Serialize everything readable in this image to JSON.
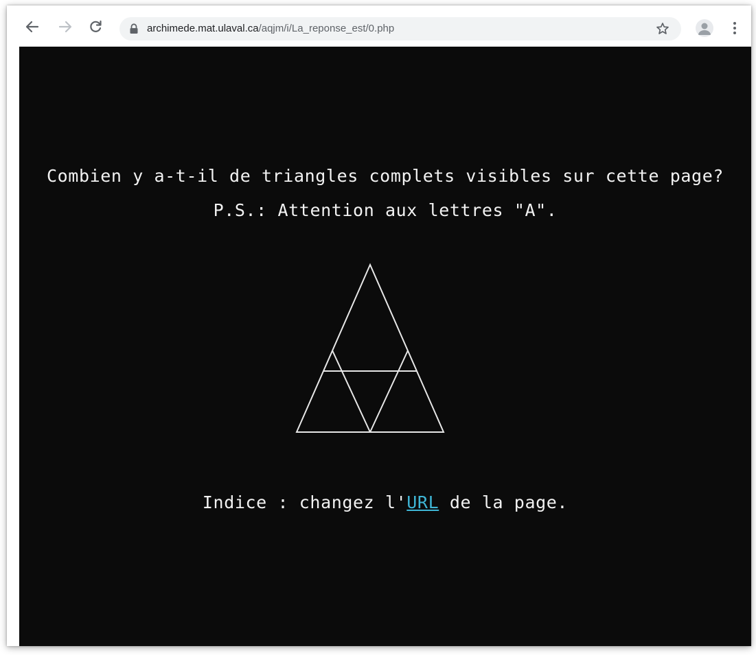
{
  "browser": {
    "url_host": "archimede.mat.ulaval.ca",
    "url_path": "/aqjm/i/La_reponse_est/0.php",
    "icons": [
      "back-arrow-icon",
      "forward-arrow-icon",
      "reload-icon",
      "lock-icon",
      "star-icon",
      "profile-avatar-icon",
      "kebab-menu-icon"
    ]
  },
  "page": {
    "question": "Combien y a-t-il de triangles complets visibles sur cette page?",
    "ps": "P.S.: Attention aux lettres \"A\".",
    "hint_before": "Indice : changez l'",
    "hint_link": "URL",
    "hint_after": " de la page."
  },
  "colors": {
    "page_background": "#0b0b0b",
    "text": "#f2f2f2",
    "link": "#3fb6d6",
    "omnibox": "#f1f3f4"
  }
}
